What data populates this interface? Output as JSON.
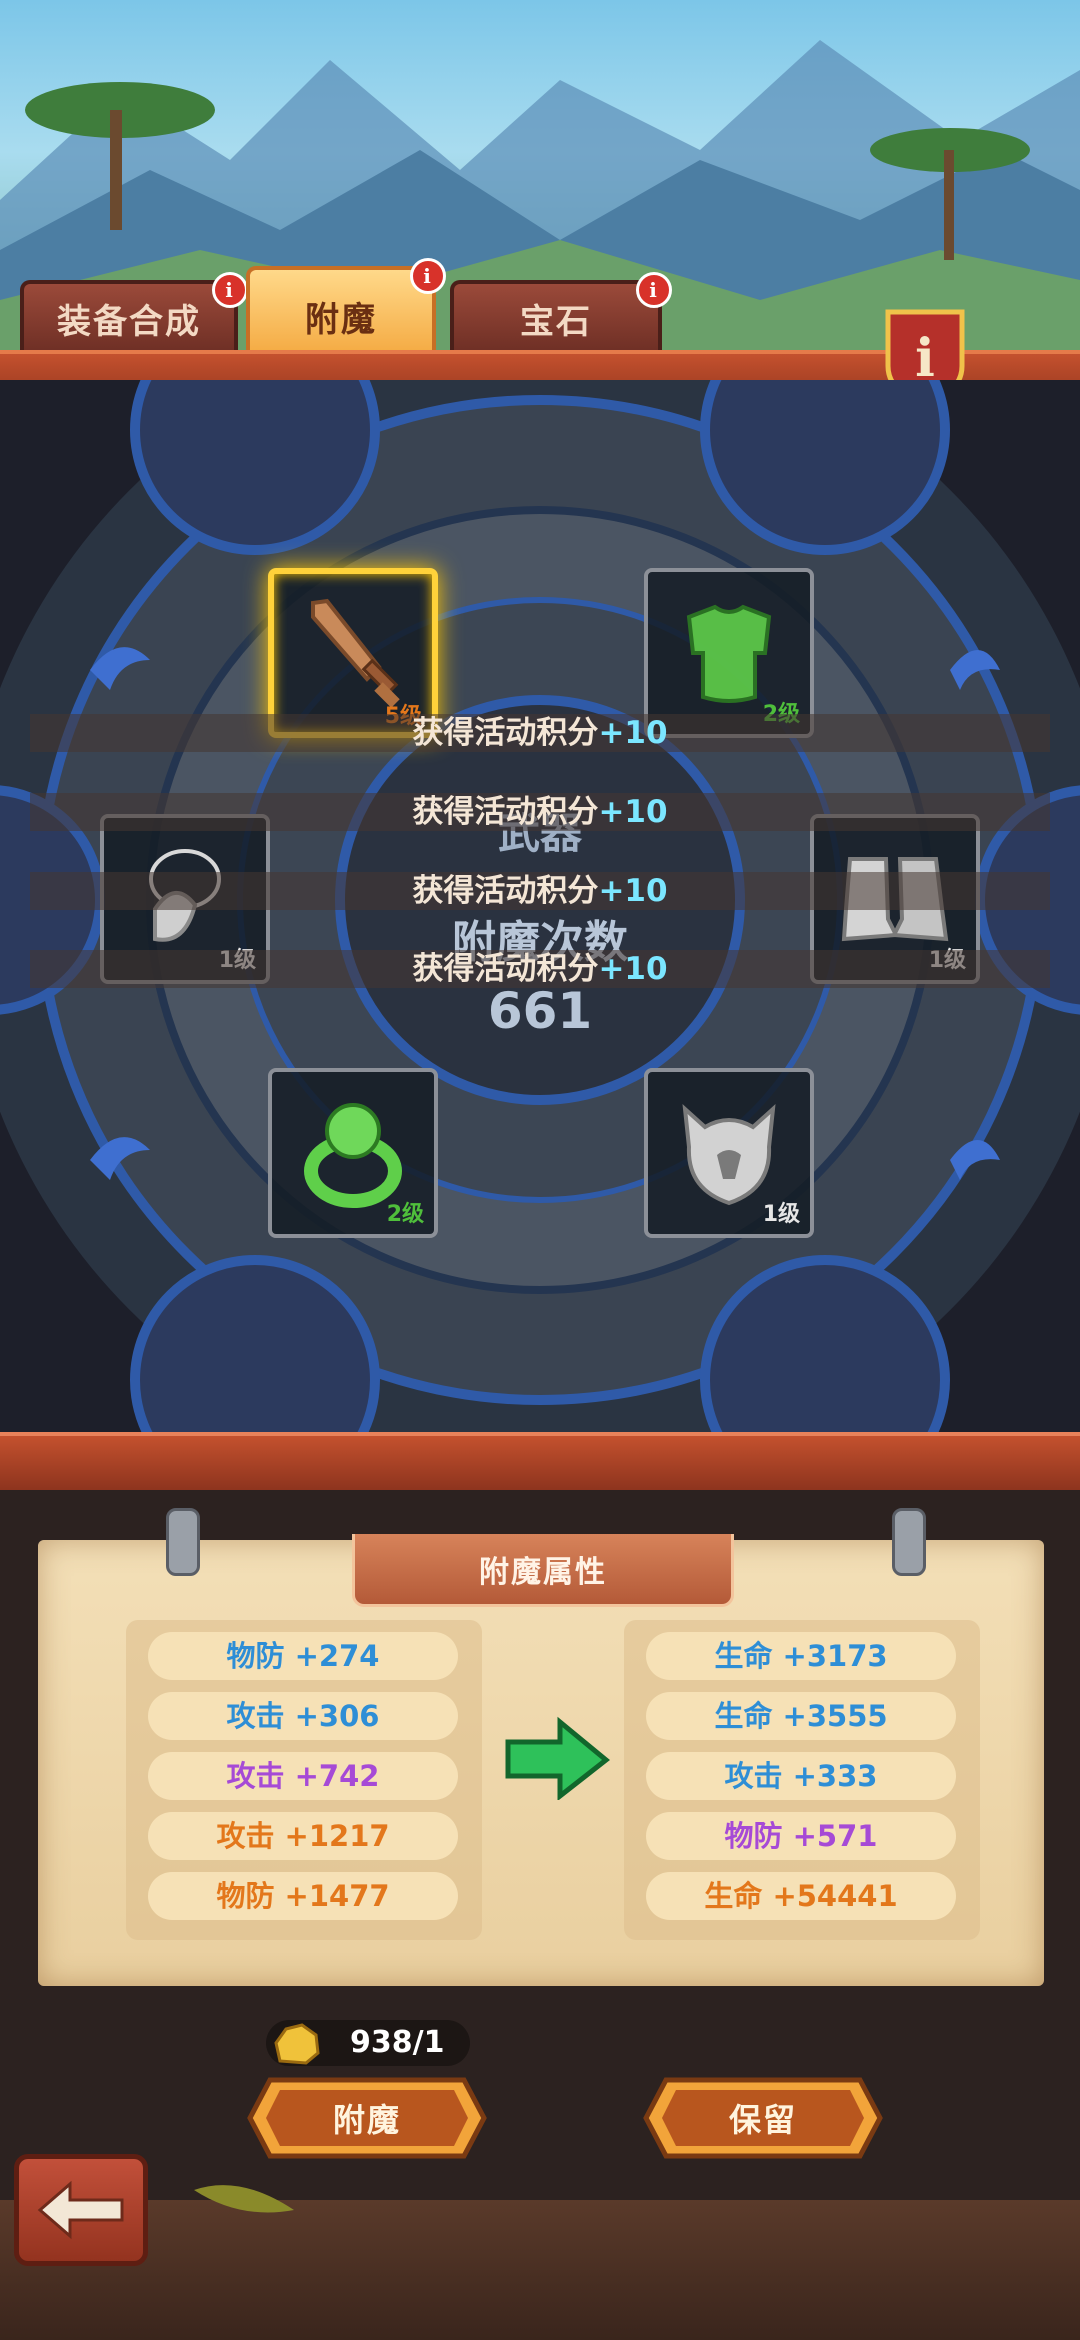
{
  "tabs": [
    {
      "label": "装备合成",
      "badge": "i",
      "active": false
    },
    {
      "label": "附魔",
      "badge": "i",
      "active": true
    },
    {
      "label": "宝石",
      "badge": "i",
      "active": false
    }
  ],
  "board": {
    "center_label": "武器",
    "count_label": "附魔次数",
    "count_value": "661",
    "slots": [
      {
        "name": "sword",
        "level": "5级",
        "level_color": "#e3771b",
        "selected": true
      },
      {
        "name": "green-armor",
        "level": "2级",
        "level_color": "#4fbf3b",
        "selected": false
      },
      {
        "name": "necklace",
        "level": "1级",
        "level_color": "#e6e6e6",
        "selected": false
      },
      {
        "name": "boots",
        "level": "1级",
        "level_color": "#e6e6e6",
        "selected": false
      },
      {
        "name": "ring",
        "level": "2级",
        "level_color": "#4fbf3b",
        "selected": false
      },
      {
        "name": "helmet",
        "level": "1级",
        "level_color": "#e6e6e6",
        "selected": false
      }
    ]
  },
  "toasts": [
    {
      "text": "获得活动积分",
      "plus": "+10"
    },
    {
      "text": "获得活动积分",
      "plus": "+10"
    },
    {
      "text": "获得活动积分",
      "plus": "+10"
    },
    {
      "text": "获得活动积分",
      "plus": "+10"
    }
  ],
  "panel": {
    "title": "附魔属性",
    "current_stats": [
      {
        "text": "物防 +274",
        "color": "blue"
      },
      {
        "text": "攻击 +306",
        "color": "blue"
      },
      {
        "text": "攻击 +742",
        "color": "purple"
      },
      {
        "text": "攻击 +1217",
        "color": "orange"
      },
      {
        "text": "物防 +1477",
        "color": "orange"
      }
    ],
    "new_stats": [
      {
        "text": "生命 +3173",
        "color": "blue"
      },
      {
        "text": "生命 +3555",
        "color": "blue"
      },
      {
        "text": "攻击 +333",
        "color": "blue"
      },
      {
        "text": "物防 +571",
        "color": "purple"
      },
      {
        "text": "生命 +54441",
        "color": "orange"
      }
    ]
  },
  "cost": {
    "value": "938/1",
    "icon": "gold-ore-icon"
  },
  "buttons": {
    "enchant": "附魔",
    "keep": "保留"
  },
  "icons": {
    "info": "info-icon",
    "back": "back-arrow-icon",
    "arrow": "green-arrow-icon"
  },
  "colors": {
    "blue": "#2e8ed6",
    "purple": "#a64ad6",
    "orange": "#e3771b",
    "accent_gold": "#ffd23a"
  }
}
